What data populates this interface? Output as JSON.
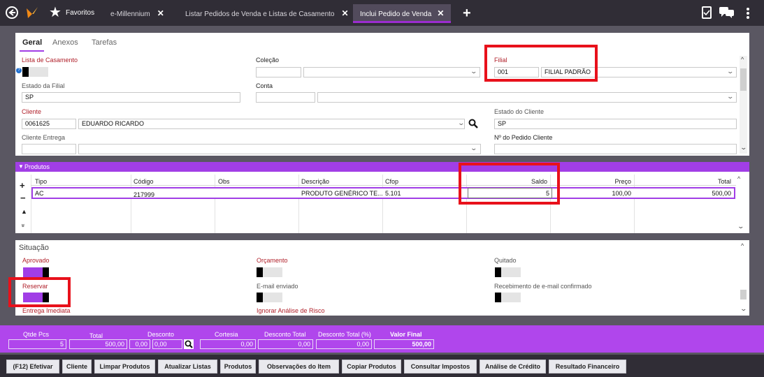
{
  "topbar": {
    "favoritos": "Favoritos",
    "tabs": [
      {
        "label": "e-Millennium"
      },
      {
        "label": "Listar Pedidos de Venda e Listas de Casamento"
      },
      {
        "label": "Inclui Pedido de Venda"
      }
    ],
    "close_glyph": "✕",
    "add_glyph": "+"
  },
  "form_tabs": [
    "Geral",
    "Anexos",
    "Tarefas"
  ],
  "header": {
    "lista_casamento_label": "Lista de Casamento",
    "colecao_label": "Coleção",
    "filial_label": "Filial",
    "filial_code": "001",
    "filial_name": "FILIAL PADRÃO",
    "estado_filial_label": "Estado da Filial",
    "estado_filial_value": "SP",
    "conta_label": "Conta",
    "cliente_label": "Cliente",
    "cliente_code": "0061625",
    "cliente_name": "EDUARDO RICARDO",
    "estado_cliente_label": "Estado do Cliente",
    "estado_cliente_value": "SP",
    "cliente_entrega_label": "Cliente Entrega",
    "pedido_cliente_label": "Nº do Pedido Cliente"
  },
  "produtos": {
    "section_label": "Produtos",
    "columns": [
      "Tipo",
      "Código",
      "Obs",
      "Descrição",
      "Cfop",
      "Saldo",
      "Preço",
      "Total"
    ],
    "rows": [
      {
        "tipo": "AC",
        "codigo": "217999",
        "obs": "",
        "descricao": "PRODUTO GENÉRICO TE...",
        "cfop": "5.101",
        "saldo": "5",
        "preco": "100,00",
        "total": "500,00"
      }
    ],
    "side_buttons": [
      "+",
      "−",
      "▲",
      "»"
    ]
  },
  "situacao": {
    "title": "Situação",
    "aprovado_label": "Aprovado",
    "aprovado_on": true,
    "orcamento_label": "Orçamento",
    "orcamento_on": false,
    "quitado_label": "Quitado",
    "quitado_on": false,
    "reservar_label": "Reservar",
    "reservar_on": true,
    "email_enviado_label": "E-mail enviado",
    "email_enviado_on": false,
    "recebimento_label": "Recebimento de e-mail confirmado",
    "recebimento_on": false,
    "entrega_imediata_label": "Entrega Imediata",
    "ignorar_risco_label": "Ignorar Análise de Risco"
  },
  "totals": {
    "qtde_pcs_label": "Qtde Pcs",
    "qtde_pcs": "5",
    "total_label": "Total",
    "total": "500,00",
    "desconto_label": "Desconto",
    "desconto_a": "0,00",
    "desconto_b": "0,00",
    "cortesia_label": "Cortesia",
    "cortesia": "0,00",
    "desconto_total_label": "Desconto Total",
    "desconto_total": "0,00",
    "desconto_total_pct_label": "Desconto Total (%)",
    "desconto_total_pct": "0,00",
    "valor_final_label": "Valor Final",
    "valor_final": "500,00"
  },
  "bottom_buttons": [
    "(F12) Efetivar",
    "Cliente",
    "Limpar Produtos",
    "Atualizar Listas",
    "Produtos",
    "Observações do Item",
    "Copiar Produtos",
    "Consultar Impostos",
    "Análise de Crédito",
    "Resultado Financeiro"
  ],
  "colors": {
    "accent": "#b046ec",
    "highlight_box": "#e8111b",
    "topbar": "#302d36"
  }
}
